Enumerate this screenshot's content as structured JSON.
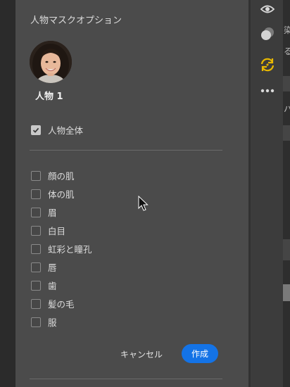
{
  "panel": {
    "title": "人物マスクオプション",
    "person_name": "人物 1",
    "whole_person": {
      "label": "人物全体",
      "checked": true
    },
    "options": [
      {
        "label": "顔の肌",
        "checked": false
      },
      {
        "label": "体の肌",
        "checked": false
      },
      {
        "label": "眉",
        "checked": false
      },
      {
        "label": "白目",
        "checked": false
      },
      {
        "label": "虹彩と瞳孔",
        "checked": false
      },
      {
        "label": "唇",
        "checked": false
      },
      {
        "label": "歯",
        "checked": false
      },
      {
        "label": "髪の毛",
        "checked": false
      },
      {
        "label": "服",
        "checked": false
      }
    ],
    "cancel_label": "キャンセル",
    "create_label": "作成"
  },
  "toolbar": {
    "tools": [
      "eye-icon",
      "mask-overlap-icon",
      "refresh-sync-icon",
      "more-icon"
    ],
    "active_tool_color": "#e8b800"
  },
  "colors": {
    "accent": "#1473e6",
    "panel_bg": "#4b4b4b"
  },
  "edge_fragments": [
    "染",
    "る",
    "ハ"
  ]
}
